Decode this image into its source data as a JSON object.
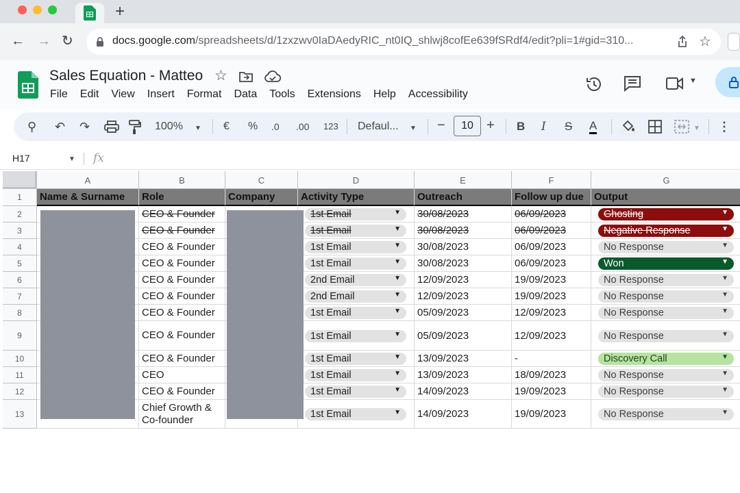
{
  "browser": {
    "tab_icon": "google-sheets-icon",
    "new_tab_label": "+",
    "url_host": "docs.google.com",
    "url_path": "/spreadsheets/d/1zxzwv0IaDAedyRIC_nt0IQ_shlwj8cofEe639fSRdf4/edit?pli=1#gid=310..."
  },
  "sheet": {
    "title": "Sales Equation - Matteo",
    "menu": [
      "File",
      "Edit",
      "View",
      "Insert",
      "Format",
      "Data",
      "Tools",
      "Extensions",
      "Help",
      "Accessibility"
    ]
  },
  "toolbar": {
    "zoom": "100%",
    "currency": "€",
    "percent": "%",
    "dec_decrease": ".0",
    "dec_increase": ".00",
    "number_format": "123",
    "font": "Defaul...",
    "font_size": "10",
    "minus": "−",
    "plus": "+",
    "bold": "B",
    "italic": "I",
    "strike": "S",
    "text_color": "A"
  },
  "formula_bar": {
    "cell_ref": "H17",
    "fx_label": "fx"
  },
  "columns": [
    "A",
    "B",
    "C",
    "D",
    "E",
    "F",
    "G"
  ],
  "headers": [
    "Name & Surname",
    "Role",
    "Company",
    "Activity Type",
    "Outreach",
    "Follow up due",
    "Output"
  ],
  "rows": [
    {
      "num": "1"
    },
    {
      "num": "2",
      "role": "CEO & Founder",
      "activity": "1st Email",
      "outreach": "30/08/2023",
      "followup": "06/09/2023",
      "output": "Ghosting",
      "strike": true
    },
    {
      "num": "3",
      "role": "CEO & Founder",
      "activity": "1st Email",
      "outreach": "30/08/2023",
      "followup": "06/09/2023",
      "output": "Negative Response",
      "strike": true
    },
    {
      "num": "4",
      "role": "CEO & Founder",
      "activity": "1st Email",
      "outreach": "30/08/2023",
      "followup": "06/09/2023",
      "output": "No Response",
      "strike": false
    },
    {
      "num": "5",
      "role": "CEO & Founder",
      "activity": "1st Email",
      "outreach": "30/08/2023",
      "followup": "06/09/2023",
      "output": "Won",
      "strike": false
    },
    {
      "num": "6",
      "role": "CEO & Founder",
      "activity": "2nd Email",
      "outreach": "12/09/2023",
      "followup": "19/09/2023",
      "output": "No Response",
      "strike": false
    },
    {
      "num": "7",
      "role": "CEO & Founder",
      "activity": "2nd Email",
      "outreach": "12/09/2023",
      "followup": "19/09/2023",
      "output": "No Response",
      "strike": false
    },
    {
      "num": "8",
      "role": "CEO & Founder",
      "activity": "1st Email",
      "outreach": "05/09/2023",
      "followup": "12/09/2023",
      "output": "No Response",
      "strike": false
    },
    {
      "num": "9",
      "role": "CEO & Founder",
      "activity": "1st Email",
      "outreach": "05/09/2023",
      "followup": "12/09/2023",
      "output": "No Response",
      "strike": false
    },
    {
      "num": "10",
      "role": "CEO & Founder",
      "activity": "1st Email",
      "outreach": "13/09/2023",
      "followup": "-",
      "output": "Discovery Call",
      "strike": false
    },
    {
      "num": "11",
      "role": "CEO",
      "activity": "1st Email",
      "outreach": "13/09/2023",
      "followup": "18/09/2023",
      "output": "No Response",
      "strike": false
    },
    {
      "num": "12",
      "role": "CEO & Founder",
      "activity": "1st Email",
      "outreach": "14/09/2023",
      "followup": "19/09/2023",
      "output": "No Response",
      "strike": false
    },
    {
      "num": "13",
      "role": "Chief Growth & Co-founder",
      "activity": "1st Email",
      "outreach": "14/09/2023",
      "followup": "19/09/2023",
      "output": "No Response",
      "strike": false
    }
  ],
  "output_styles": {
    "Ghosting": {
      "bg": "#8b0d0d",
      "fg": "#ffffff"
    },
    "Negative Response": {
      "bg": "#8b0d0d",
      "fg": "#ffffff"
    },
    "No Response": {
      "bg": "#e2e2e2",
      "fg": "#3c4043"
    },
    "Won": {
      "bg": "#0b5a2c",
      "fg": "#ffffff"
    },
    "Discovery Call": {
      "bg": "#b6e3a0",
      "fg": "#1e4620"
    }
  },
  "colors": {
    "header_fill": "#7b7b7b",
    "redaction": "#8e929c",
    "activity_chip": "#e2e2e2"
  }
}
